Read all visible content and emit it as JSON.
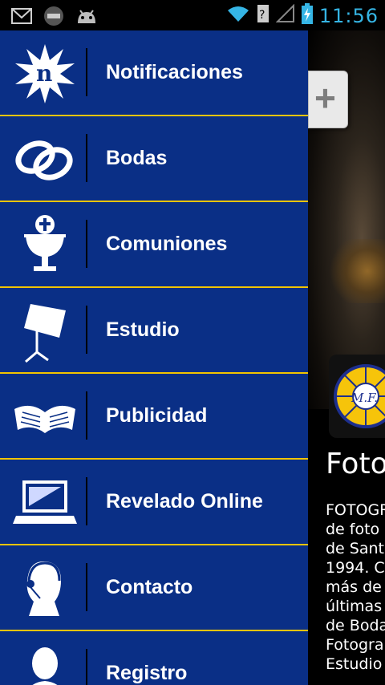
{
  "status_bar": {
    "time": "11:56"
  },
  "menu": {
    "items": [
      {
        "label": "Notificaciones",
        "icon": "notification-badge-icon"
      },
      {
        "label": "Bodas",
        "icon": "wedding-rings-icon"
      },
      {
        "label": "Comuniones",
        "icon": "chalice-icon"
      },
      {
        "label": "Estudio",
        "icon": "studio-light-icon"
      },
      {
        "label": "Publicidad",
        "icon": "open-book-icon"
      },
      {
        "label": "Revelado Online",
        "icon": "laptop-icon"
      },
      {
        "label": "Contacto",
        "icon": "headset-contact-icon"
      },
      {
        "label": "Registro",
        "icon": "user-icon"
      }
    ]
  },
  "content": {
    "title": "Foto",
    "logo_text": "M.F.",
    "body_lines": [
      "FOTOGR",
      "de foto",
      "de Sant",
      "1994. C",
      "más de",
      "últimas",
      "de Boda",
      "Fotogra",
      "Estudio"
    ]
  },
  "colors": {
    "drawer_bg": "#0a2f86",
    "separator": "#f2c400",
    "clock": "#35b5e5"
  }
}
